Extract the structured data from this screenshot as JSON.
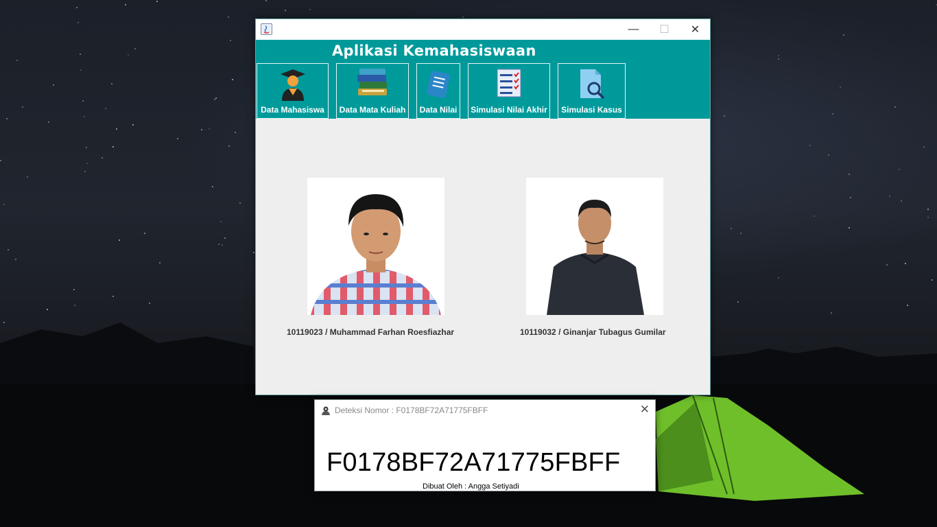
{
  "main_window": {
    "app_title": "Aplikasi Kemahasiswaan",
    "window_controls": [
      "minimize",
      "maximize",
      "close"
    ],
    "nav": [
      {
        "label": "Data Mahasiswa",
        "icon": "graduate-icon"
      },
      {
        "label": "Data Mata Kuliah",
        "icon": "books-icon"
      },
      {
        "label": "Data Nilai",
        "icon": "scroll-icon"
      },
      {
        "label": "Simulasi Nilai Akhir",
        "icon": "checklist-icon"
      },
      {
        "label": "Simulasi Kasus",
        "icon": "document-search-icon"
      }
    ],
    "students": [
      {
        "caption": "10119023 / Muhammad Farhan Roesfiazhar"
      },
      {
        "caption": "10119032 / Ginanjar Tubagus Gumilar"
      }
    ]
  },
  "dialog": {
    "title": "Deteksi Nomor : F0178BF72A71775FBFF",
    "value": "F0178BF72A71775FBFF",
    "credit": "Dibuat Oleh : Angga Setiyadi"
  },
  "colors": {
    "header_teal": "#00999a",
    "content_bg": "#eeeeee"
  }
}
